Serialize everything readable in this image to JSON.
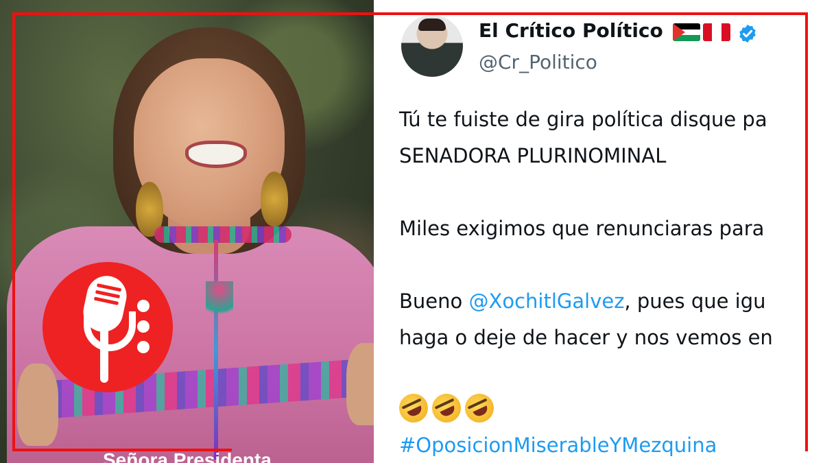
{
  "photo": {
    "caption": "Señora Presidenta",
    "logo_icon": "microphone-icon"
  },
  "tweet": {
    "author_name": "El Crítico Político",
    "flags": [
      "palestine-flag",
      "peru-flag"
    ],
    "verified_icon": "verified-badge-icon",
    "handle": "@Cr_Politico",
    "lines": [
      "Tú te fuiste de gira política disque pa",
      "SENADORA PLURINOMINAL",
      "Miles exigimos que renunciaras para",
      "haga o deje de hacer y nos vemos en"
    ],
    "line3_prefix": "Bueno ",
    "mention": "@XochitlGalvez",
    "line3_suffix": ", pues que igu",
    "emojis": [
      "rofl-emoji",
      "rofl-emoji",
      "rofl-emoji"
    ],
    "hashtag": "#OposicionMiserableYMezquina"
  },
  "colors": {
    "frame_red": "#ee1111",
    "logo_red": "#ee2222",
    "link_blue": "#1d9bf0",
    "verified_blue": "#1d9bf0"
  }
}
